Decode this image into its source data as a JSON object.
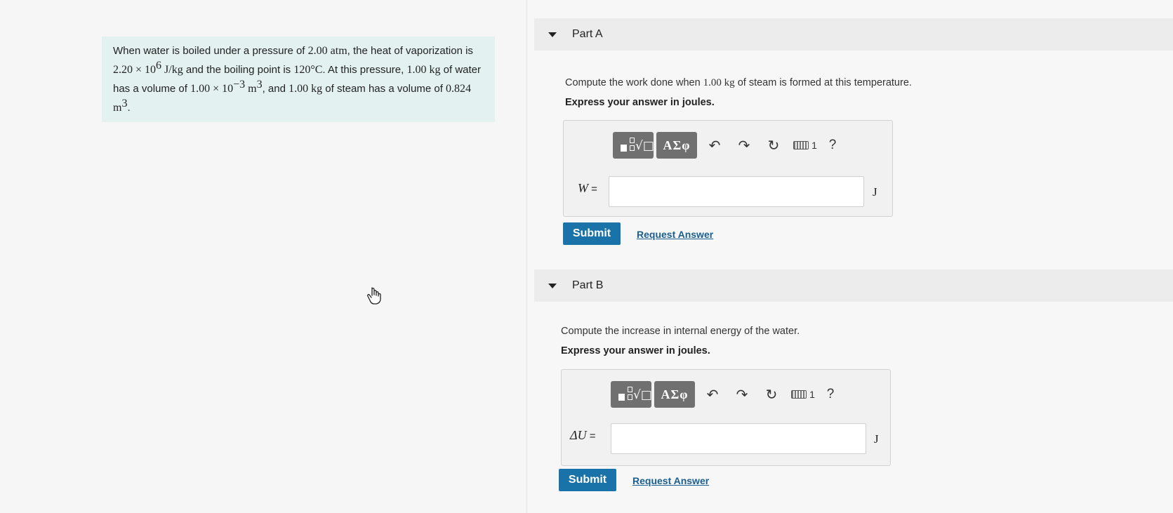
{
  "problem": {
    "t1": "When water is boiled under a pressure of ",
    "m1": "2.00 atm",
    "t2": ", the heat of vaporization is ",
    "m2a": "2.20 × 10",
    "m2sup": "6",
    "m2b": " J/kg",
    "t3": " and the boiling point is ",
    "m3": "120°C",
    "t4": ". At this pressure, ",
    "m4": "1.00 kg",
    "t5": " of water has a volume of ",
    "m5a": "1.00 × 10",
    "m5sup": "−3",
    "m5b": " m",
    "m5sup2": "3",
    "t6": ", and ",
    "m6": "1.00 kg",
    "t7": " of steam has a volume of ",
    "m7a": "0.824 m",
    "m7sup": "3",
    "t8": "."
  },
  "partA": {
    "title": "Part A",
    "q1": "Compute the work done when ",
    "qm": "1.00 kg",
    "q2": " of steam is formed at this temperature.",
    "instruction": "Express your answer in joules.",
    "var": "W",
    "eq": " =",
    "value": "",
    "unit": "J",
    "submit": "Submit",
    "request": "Request Answer"
  },
  "partB": {
    "title": "Part B",
    "question": "Compute the increase in internal energy of the water.",
    "instruction": "Express your answer in joules.",
    "var": "ΔU",
    "eq": " =",
    "value": "",
    "unit": "J",
    "submit": "Submit",
    "request": "Request Answer"
  },
  "toolbar": {
    "greek": "ΑΣφ",
    "undo": "↶",
    "redo": "↷",
    "reset": "↻",
    "kbd_suffix": "1",
    "help": "?"
  },
  "icons": {
    "template": "template-radical-icon",
    "undo": "undo-icon",
    "redo": "redo-icon",
    "reset": "reset-icon",
    "keyboard": "keyboard-icon",
    "help": "help-icon",
    "cursor": "hand-cursor-icon"
  },
  "colors": {
    "submit": "#1a73a8",
    "problem_bg": "#e3f1f1",
    "link": "#1a5f8f"
  }
}
